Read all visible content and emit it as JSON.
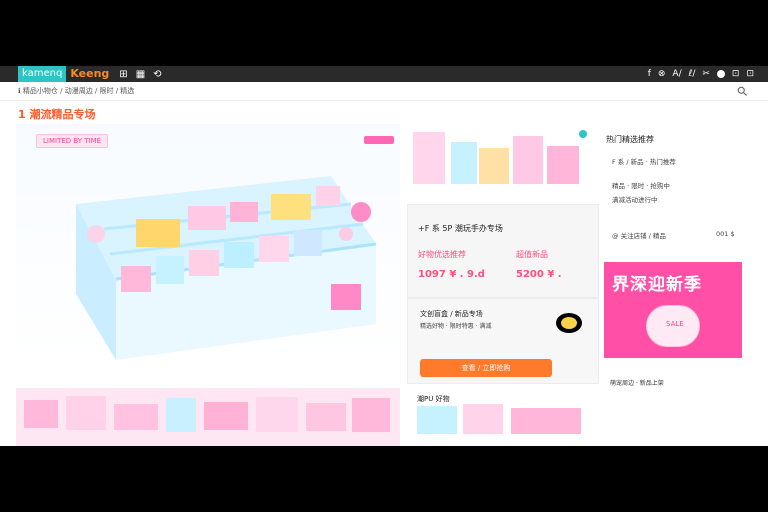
{
  "app": {
    "brand_left": "kamenq",
    "brand_right": "Keeng",
    "topbar_icons": [
      "⊞",
      "▦",
      "⟲"
    ],
    "right_icons": [
      "f",
      "⊗",
      "A/",
      "ℓ/",
      "✂",
      "⊡",
      "⊡"
    ]
  },
  "url": {
    "text": "ℹ 精品小物仓 / 动漫周边 / 限时 / 精选"
  },
  "page": {
    "title": "1 潮流精品专场"
  },
  "hero": {
    "badge": "LIMITED BY TIME"
  },
  "middle": {
    "card_title": "+F 系 5P 潮玩手办专场",
    "left_title": "好物优选推荐",
    "left_price": "1097 ¥ . 9.d",
    "right_title": "超值新品",
    "right_price": "5200 ¥ .",
    "promo_text": "文创盲盒 / 新品专场",
    "promo_line2": "精选好物 · 限时特惠 · 满减",
    "cta_label": "查看 / 立即抢购",
    "bottom_label": "潮PU 好物"
  },
  "right": {
    "header": "热门精选推荐",
    "line1": "F 系 / 新品  · 热门推荐",
    "line2": "精品  ·  限时 · 抢购中",
    "line3": "满减活动进行中",
    "line4": "@ 关注店铺 / 精品",
    "line4_right": "001 $",
    "promo_big": "界深迎新季",
    "pill_text": "SALE",
    "bottom_text": "萌宠周边 · 新品上架"
  }
}
